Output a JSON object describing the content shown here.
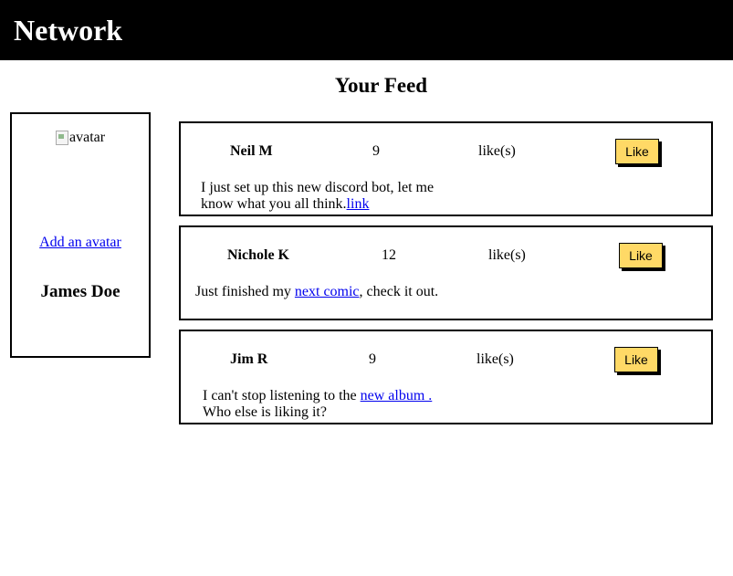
{
  "header": {
    "brand": "Network"
  },
  "page_title": "Your Feed",
  "profile": {
    "avatar_alt": "avatar",
    "add_avatar_label": "Add an avatar",
    "user_name": "James Doe"
  },
  "posts": [
    {
      "author": "Neil M",
      "likes": "9",
      "likes_label": "like(s)",
      "like_button": "Like",
      "text_before": "I just set up this new discord bot, let me know what you all think.",
      "link_text": "link",
      "text_after": ""
    },
    {
      "author": "Nichole K",
      "likes": "12",
      "likes_label": "like(s)",
      "like_button": "Like",
      "text_before": "Just finished my ",
      "link_text": "next comic",
      "text_after": ", check it out."
    },
    {
      "author": "Jim R",
      "likes": "9",
      "likes_label": "like(s)",
      "like_button": "Like",
      "text_before": "I can't stop listening to the ",
      "link_text": "new album .",
      "text_after": " Who else is liking it?"
    }
  ]
}
